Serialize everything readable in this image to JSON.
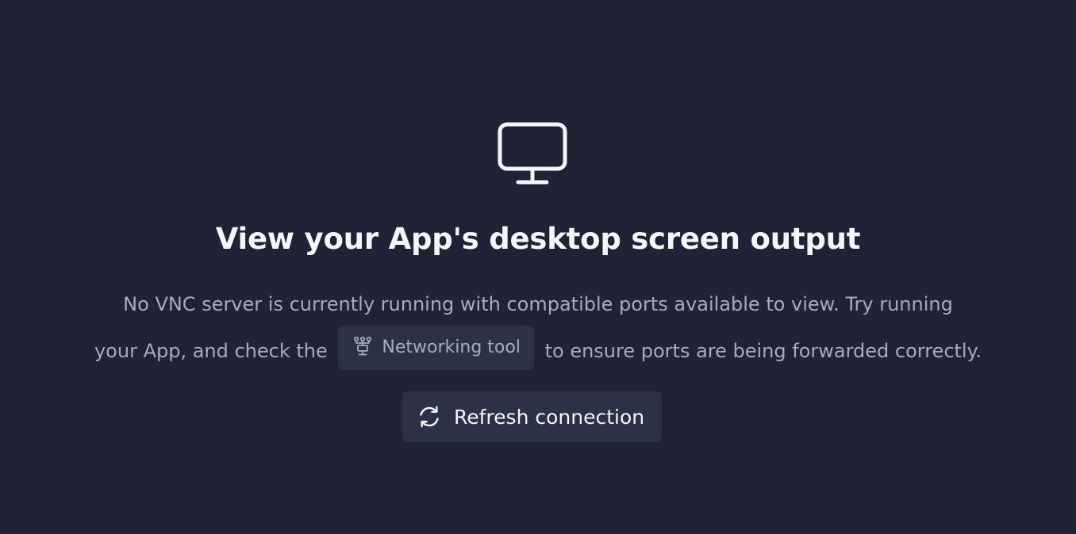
{
  "empty_state": {
    "icon": "monitor-icon",
    "title": "View your App's desktop screen output",
    "description": {
      "line1": "No VNC server is currently running with compatible ports available to view. Try running",
      "line2_before": "your App, and check the",
      "tool_link": {
        "icon": "network-icon",
        "label": "Networking tool"
      },
      "line2_after": "to ensure ports are being forwarded correctly."
    },
    "refresh_button": {
      "icon": "refresh-icon",
      "label": "Refresh connection"
    }
  },
  "colors": {
    "background": "#1f2335",
    "surface": "#2c3145",
    "text_primary": "#f5f6f8",
    "text_secondary": "#a7acb9"
  }
}
